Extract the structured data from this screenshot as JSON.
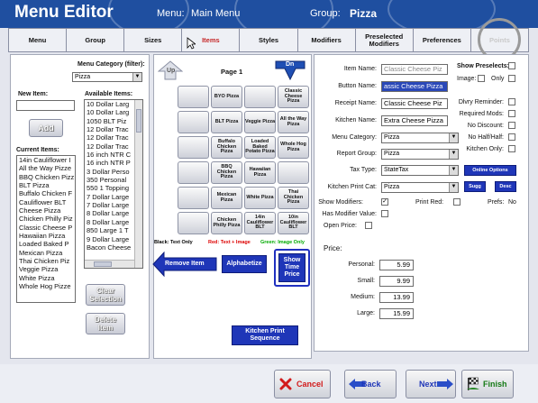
{
  "header": {
    "title": "Menu Editor",
    "menu_label": "Menu:",
    "menu_value": "Main Menu",
    "group_label": "Group:",
    "group_value": "Pizza"
  },
  "tabs": [
    {
      "label": "Menu"
    },
    {
      "label": "Group"
    },
    {
      "label": "Sizes"
    },
    {
      "label": "Items"
    },
    {
      "label": "Styles"
    },
    {
      "label": "Modifiers"
    },
    {
      "label": "Preselected Modifiers"
    },
    {
      "label": "Preferences"
    },
    {
      "label": "Points"
    }
  ],
  "left": {
    "category_label": "Menu Category (filter):",
    "category_value": "Pizza",
    "new_item_label": "New Item:",
    "new_item_value": "",
    "add_label": "Add",
    "available_label": "Available Items:",
    "available_items": [
      "10 Dollar Larg",
      "10 Dollar Larg",
      "1050 BLT Piz",
      "12 Dollar Trac",
      "12 Dollar Trac",
      "12 Dollar Trac",
      "16 inch NTR C",
      "16 inch NTR P",
      "3 Dollar Perso",
      "350 Personal",
      "550 1 Topping",
      "7 Dollar Large",
      "7 Dollar Large",
      "8 Dollar Large",
      "8 Dollar Large",
      "850 Large 1 T",
      "9 Dollar Large",
      "Bacon Cheese"
    ],
    "current_label": "Current Items:",
    "current_items": [
      "14in Cauliflower I",
      "All the Way Pizze",
      "BBQ Chicken Pizz",
      "BLT Pizza",
      "Buffalo Chicken F",
      "Cauliflower BLT",
      "Cheese Pizza",
      "Chicken Philly Piz",
      "Classic Cheese P",
      "Hawaiian Pizza",
      "Loaded Baked P",
      "Mexican Pizza",
      "Thai Chicken Piz",
      "Veggie Pizza",
      "White Pizza",
      "Whole Hog Pizze"
    ],
    "clear_label": "Clear Selection",
    "delete_label": "Delete Item"
  },
  "middle": {
    "page_label": "Page 1",
    "up_label": "Up",
    "down_label": "Dn",
    "buttons": [
      [
        "",
        "BYO Pizza",
        "",
        "Classic Cheese Pizza"
      ],
      [
        "",
        "BLT Pizza",
        "Veggie Pizza",
        "All the Way Pizza"
      ],
      [
        "",
        "Buffalo Chicken Pizza",
        "Loaded Baked Potato Pizza",
        "Whole Hog Pizza"
      ],
      [
        "",
        "BBQ Chicken Pizza",
        "Hawaiian Pizza",
        ""
      ],
      [
        "",
        "Mexican Pizza",
        "White Pizza",
        "Thai Chicken Pizza"
      ],
      [
        "",
        "Chicken Philly Pizza",
        "14in Cauliflower BLT",
        "10in Cauliflower BLT"
      ]
    ],
    "legend_black": "Black: Text Only",
    "legend_red": "Red: Text + Image",
    "legend_green": "Green: Image Only",
    "remove_label": "Remove Item",
    "alphabetize_label": "Alphabetize",
    "show_price_label": "Show Time Price",
    "kitchen_seq_label": "Kitchen Print Sequence"
  },
  "right": {
    "item_name_label": "Item Name:",
    "item_name_value": "Classic Cheese Piz",
    "button_name_label": "Button Name:",
    "button_name_value": "assic Cheese Pizza",
    "receipt_name_label": "Receipt Name:",
    "receipt_name_value": "Classic Cheese Piz",
    "kitchen_name_label": "Kitchen Name:",
    "kitchen_name_value": "Extra Cheese Pizza",
    "menu_category_label": "Menu Category:",
    "menu_category_value": "Pizza",
    "report_group_label": "Report Group:",
    "report_group_value": "Pizza",
    "tax_type_label": "Tax Type:",
    "tax_type_value": "StateTax",
    "kitchen_print_label": "Kitchen Print Cat:",
    "kitchen_print_value": "Pizza",
    "show_modifiers_label": "Show Modifiers:",
    "print_red_label": "Print Red:",
    "prefs_label": "Prefs:",
    "prefs_value": "No",
    "has_modifier_label": "Has Modifier Value:",
    "open_price_label": "Open Price:",
    "show_presel_label": "Show Preselects:",
    "image_label": "Image:",
    "only_label": "Only",
    "dlvry_label": "Dlvry Reminder:",
    "required_mods_label": "Required Mods:",
    "no_discount_label": "No Discount:",
    "no_half_label": "No Half/Half:",
    "kitchen_only_label": "Kitchen Only:",
    "online_options_label": "Online Options",
    "sugg_label": "Sugg",
    "desc_label": "Desc",
    "price_label": "Price:",
    "prices": [
      {
        "label": "Personal:",
        "value": "5.99"
      },
      {
        "label": "Small:",
        "value": "9.99"
      },
      {
        "label": "Medium:",
        "value": "13.99"
      },
      {
        "label": "Large:",
        "value": "15.99"
      }
    ]
  },
  "bottom": {
    "cancel_label": "Cancel",
    "back_label": "Back",
    "next_label": "Next",
    "finish_label": "Finish"
  }
}
